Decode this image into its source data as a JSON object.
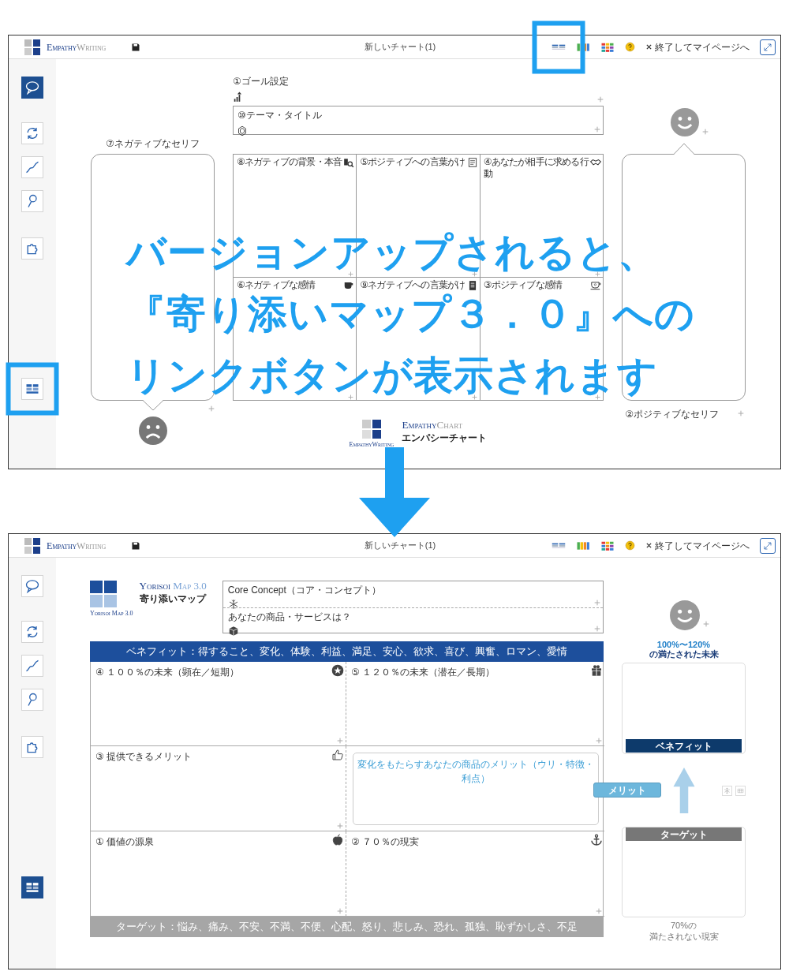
{
  "screens": [
    {
      "kind": "empathy",
      "header": {
        "brand": {
          "first": "Empathy",
          "second": "Writing"
        },
        "title": "新しいチャート(1)",
        "exit": "終了してマイページへ",
        "tools": [
          {
            "highlighted": true
          },
          {
            "highlighted": false
          },
          {
            "highlighted": false
          },
          {
            "highlighted": false
          }
        ]
      },
      "sidebar": [
        {
          "selected": true,
          "highlighted": false
        },
        {
          "selected": false,
          "highlighted": false
        },
        {
          "selected": false,
          "highlighted": false
        },
        {
          "selected": false,
          "highlighted": false
        },
        {
          "selected": false,
          "highlighted": false
        },
        {
          "selected": false,
          "highlighted": true
        }
      ],
      "chart": {
        "goal_label": "①ゴール設定",
        "theme_label": "⑩テーマ・タイトル",
        "negative_label": "⑦ネガティブなセリフ",
        "positive_label": "②ポジティブなセリフ",
        "cells": [
          "⑧ネガティブの背景・本音",
          "⑤ポジティブへの言葉がけ",
          "④あなたが相手に求める行動",
          "⑥ネガティブな感情",
          "⑨ネガティブへの言葉がけ",
          "③ポジティブな感情"
        ],
        "logo": {
          "first": "Empathy",
          "second": "Chart",
          "caption": "エンパシーチャート",
          "sub": "EmpathyWriting"
        }
      }
    },
    {
      "kind": "yorisoi",
      "header": {
        "brand": {
          "first": "Empathy",
          "second": "Writing"
        },
        "title": "新しいチャート(1)",
        "exit": "終了してマイページへ",
        "tools": [
          {
            "highlighted": false
          },
          {
            "highlighted": false
          },
          {
            "highlighted": false
          },
          {
            "highlighted": false
          }
        ]
      },
      "sidebar": [
        {
          "selected": false,
          "highlighted": false
        },
        {
          "selected": false,
          "highlighted": false
        },
        {
          "selected": false,
          "highlighted": false
        },
        {
          "selected": false,
          "highlighted": false
        },
        {
          "selected": false,
          "highlighted": false
        },
        {
          "selected": true,
          "highlighted": false
        }
      ],
      "chart": {
        "logo": {
          "first": "Yorisoi",
          "second": "Map 3.0",
          "caption": "寄り添いマップ",
          "sub": "Yorisoi Map 3.0"
        },
        "concept": [
          "Core Concept（コア・コンセプト）",
          "あなたの商品・サービスは？"
        ],
        "benefit_banner": "ベネフィット：得すること、変化、体験、利益、満足、安心、欲求、喜び、興奮、ロマン、愛情",
        "cells": [
          {
            "kind": "label",
            "text": "④ １００％の未来（顕在／短期）"
          },
          {
            "kind": "label",
            "text": "⑤ １２０％の未来（潜在／長期）"
          },
          {
            "kind": "label",
            "text": "③ 提供できるメリット"
          },
          {
            "kind": "merit",
            "text": "変化をもたらすあなたの商品のメリット（ウリ・特徴・利点）"
          },
          {
            "kind": "label",
            "text": "① 価値の源泉"
          },
          {
            "kind": "label",
            "text": "② ７０％の現実"
          }
        ],
        "target_banner": "ターゲット：悩み、痛み、不安、不満、不便、心配、怒り、悲しみ、恐れ、孤独、恥ずかしさ、不足",
        "future": [
          "100%〜120%",
          "の満たされた未来"
        ],
        "benefit_tag": "ベネフィット",
        "merit_tag": "メリット",
        "target_tag": "ターゲット",
        "reality": [
          "70%の",
          "満たされない現実"
        ]
      }
    }
  ],
  "annotation": [
    "バージョンアップされると、",
    "『寄り添いマップ３．０』への",
    "リンクボタンが表示されます"
  ]
}
